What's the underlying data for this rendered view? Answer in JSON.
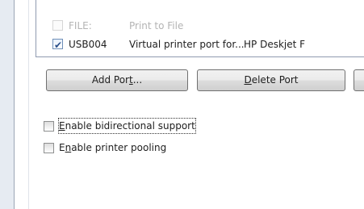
{
  "ports": [
    {
      "port": "FILE:",
      "description": "Print to File",
      "printer": "",
      "checked": false,
      "enabled": false
    },
    {
      "port": "USB004",
      "description": "Virtual printer port for...",
      "printer": "HP Deskjet F",
      "checked": true,
      "enabled": true
    }
  ],
  "buttons": {
    "add_port": {
      "before": "Add Por",
      "accel": "t",
      "after": "..."
    },
    "delete_port": {
      "before": "",
      "accel": "D",
      "after": "elete Port"
    }
  },
  "options": {
    "bidirectional": {
      "before": "",
      "accel": "E",
      "after": "nable bidirectional support",
      "checked": false
    },
    "pooling": {
      "before": "E",
      "accel": "n",
      "after": "able printer pooling",
      "checked": false
    }
  },
  "colors": {
    "background": "#e6ebf2",
    "panel": "#ffffff",
    "disabled_text": "#b4b4b4",
    "text": "#1e1e1e"
  }
}
